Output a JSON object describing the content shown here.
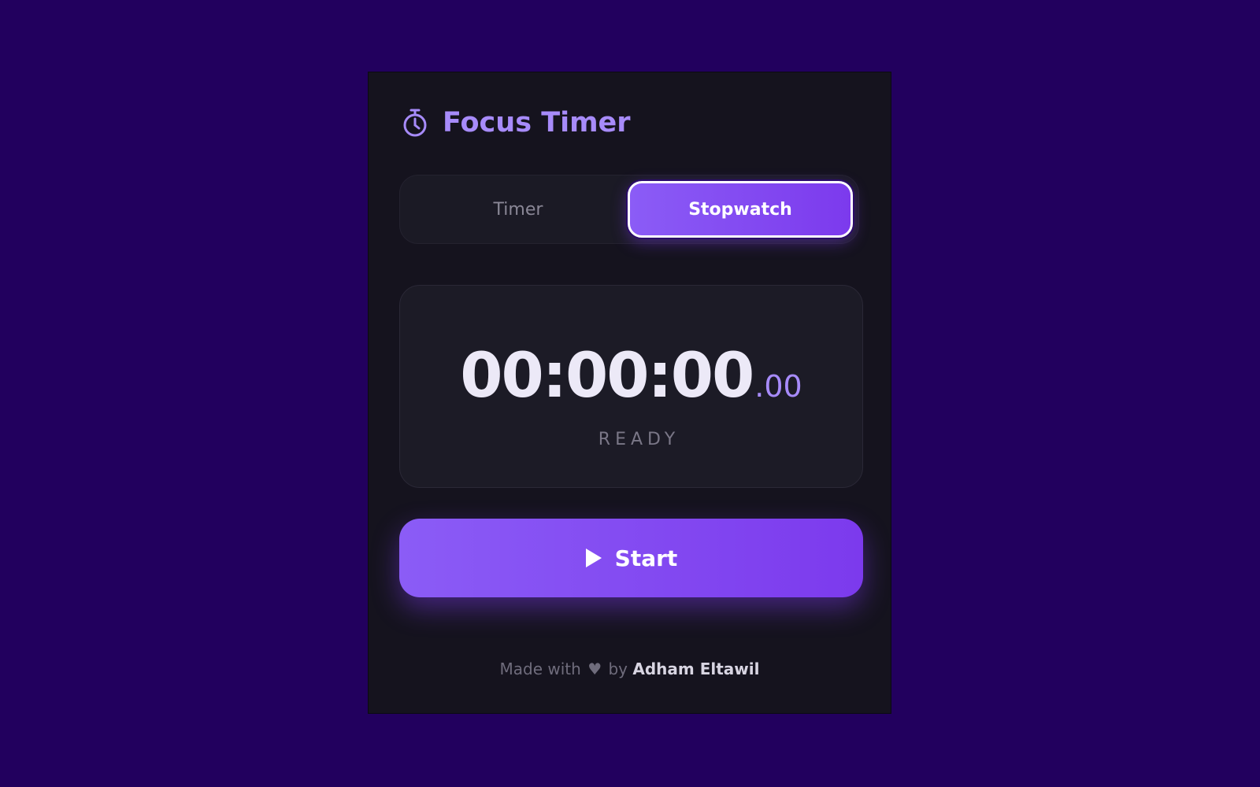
{
  "app": {
    "title": "Focus Timer",
    "icon": "stopwatch-icon",
    "accent_color": "#a78bfa",
    "primary_color": "#8b5cf6",
    "background_color": "#22005e"
  },
  "tabs": [
    {
      "label": "Timer",
      "active": false
    },
    {
      "label": "Stopwatch",
      "active": true
    }
  ],
  "display": {
    "time": "00:00:00",
    "milliseconds": ".00",
    "status": "READY"
  },
  "start_button": {
    "icon": "play-icon",
    "label": "Start"
  },
  "footer": {
    "prefix": "Made with",
    "heart": "♥",
    "by": "by",
    "author": "Adham Eltawil"
  }
}
